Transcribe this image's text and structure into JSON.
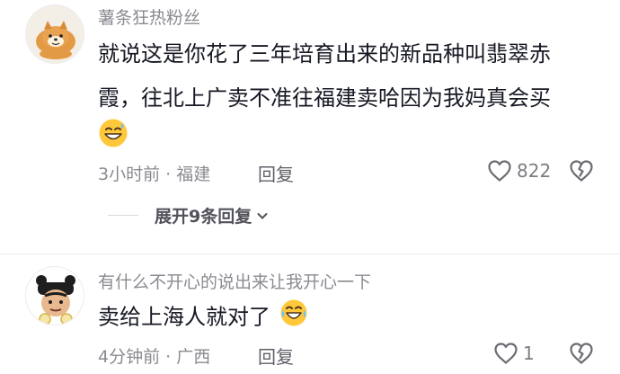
{
  "comments": [
    {
      "username": "薯条狂热粉丝",
      "text_line1": "就说这是你花了三年培育出来的新品种叫翡翠赤",
      "text_line2": "霞，往北上广卖不准往福建卖哈因为我妈真会买",
      "emoji": "grinning-sweat-emoji",
      "meta": "3小时前 · 福建",
      "reply_label": "回复",
      "like_count": "822",
      "expand_label": "展开9条回复",
      "avatar": "shiba-dog-avatar"
    },
    {
      "username": "有什么不开心的说出来让我开心一下",
      "text": "卖给上海人就对了",
      "emoji": "laughing-tears-emoji",
      "meta": "4分钟前 · 广西",
      "reply_label": "回复",
      "like_count": "1",
      "avatar": "cartoon-character-avatar"
    }
  ],
  "icons": {
    "like": "heart-outline-icon",
    "dislike": "broken-heart-icon",
    "expand": "chevron-down-icon"
  },
  "colors": {
    "text": "#161823",
    "secondary": "#8a8b91",
    "emoji_yellow": "#ffc83a"
  }
}
